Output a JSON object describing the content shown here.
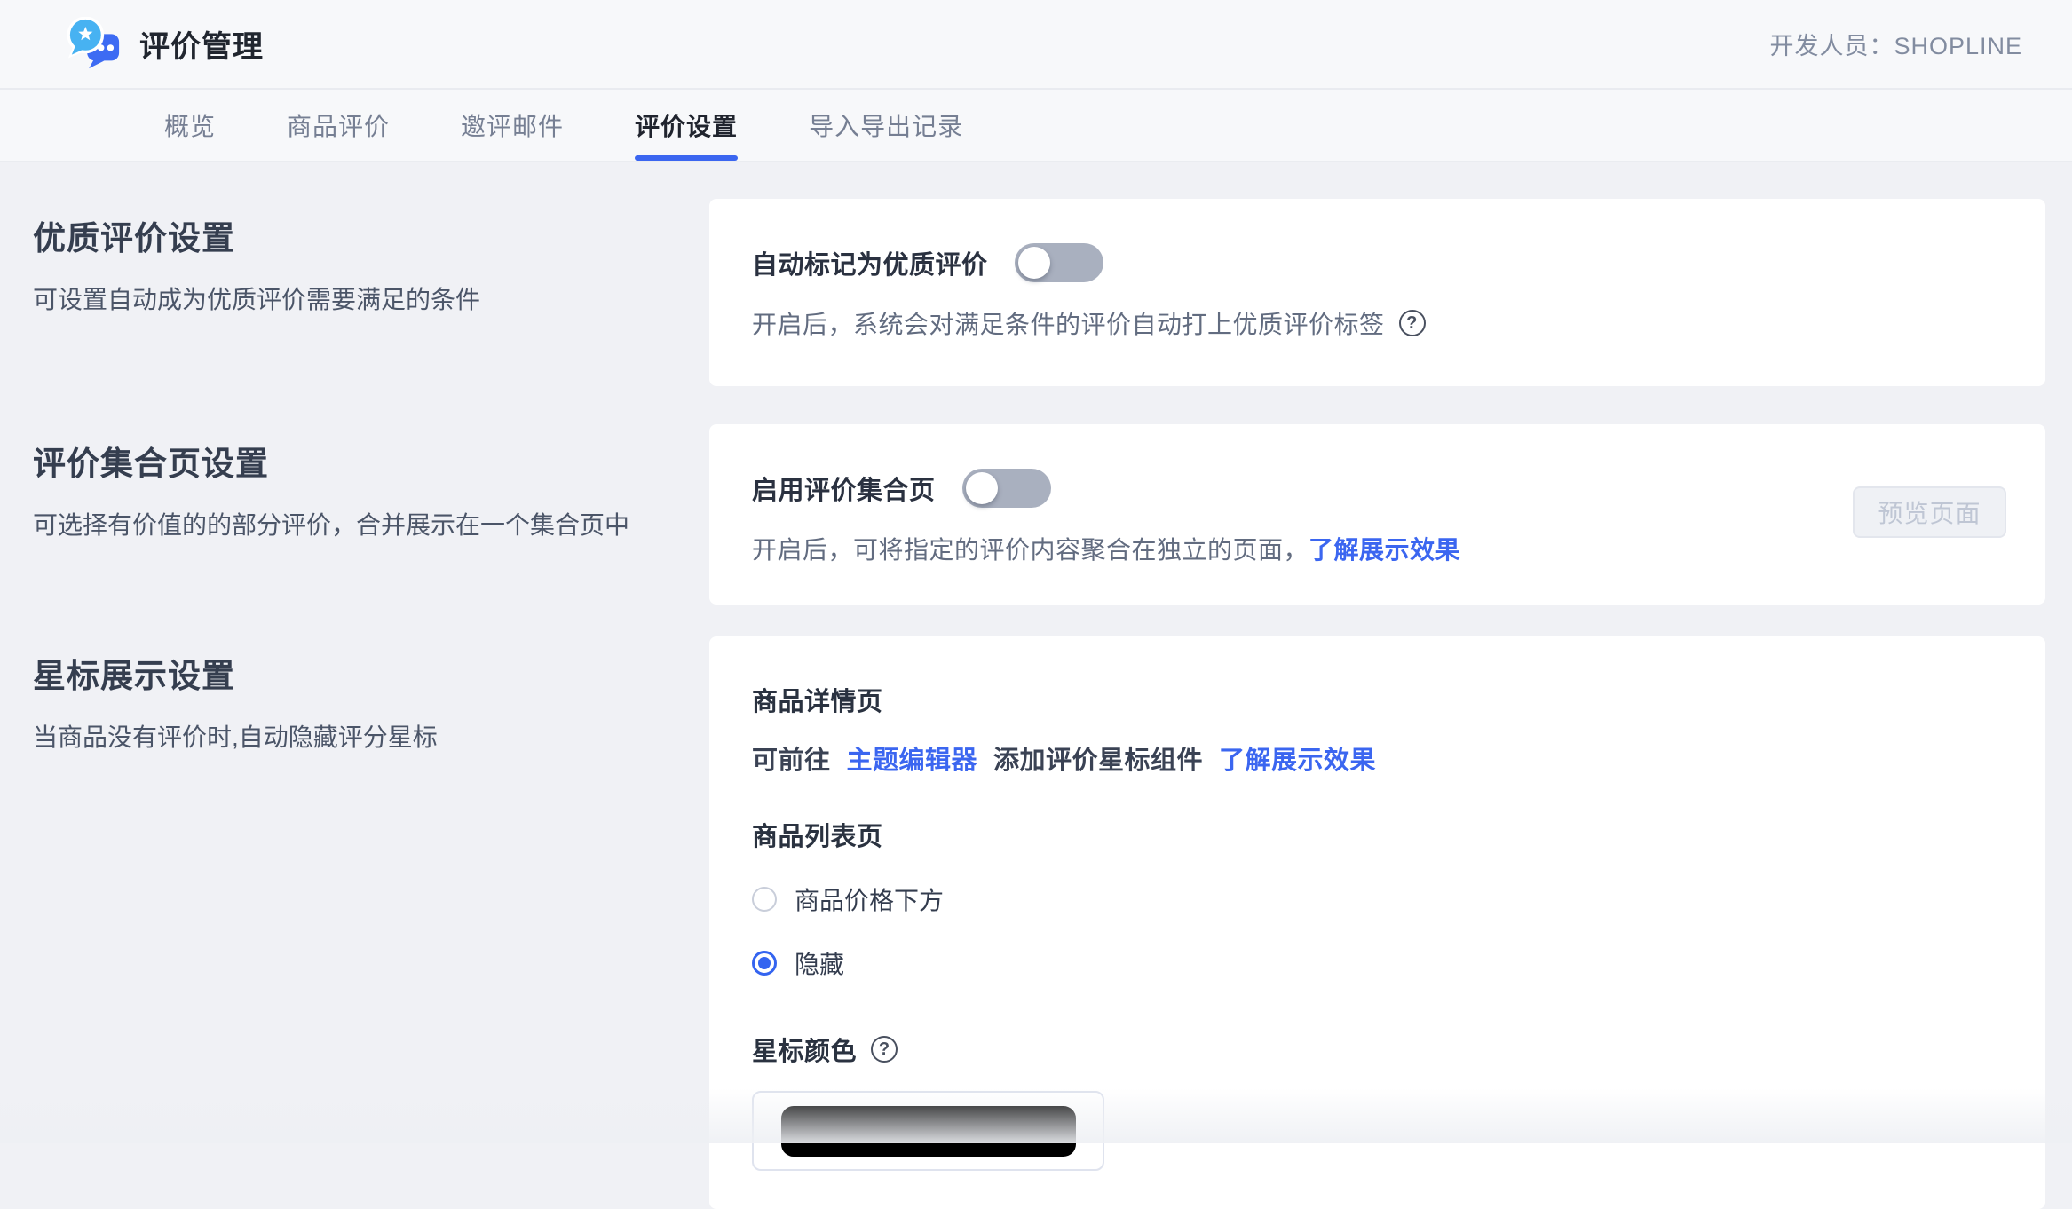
{
  "header": {
    "title": "评价管理",
    "right_text": "开发人员：SHOPLINE"
  },
  "tabs": [
    {
      "label": "概览",
      "active": false
    },
    {
      "label": "商品评价",
      "active": false
    },
    {
      "label": "邀评邮件",
      "active": false
    },
    {
      "label": "评价设置",
      "active": true
    },
    {
      "label": "导入导出记录",
      "active": false
    }
  ],
  "sections": [
    {
      "title": "优质评价设置",
      "description": "可设置自动成为优质评价需要满足的条件",
      "card": {
        "toggle_label": "自动标记为优质评价",
        "toggle_on": false,
        "description": "开启后，系统会对满足条件的评价自动打上优质评价标签"
      }
    },
    {
      "title": "评价集合页设置",
      "description": "可选择有价值的的部分评价，合并展示在一个集合页中",
      "card": {
        "toggle_label": "启用评价集合页",
        "toggle_on": false,
        "description_prefix": "开启后，可将指定的评价内容聚合在独立的页面，",
        "description_link": "了解展示效果",
        "preview_button_label": "预览页面",
        "preview_button_enabled": false
      }
    },
    {
      "title": "星标展示设置",
      "description": "当商品没有评价时,自动隐藏评分星标",
      "card": {
        "detail_page_label": "商品详情页",
        "detail_line": {
          "prefix": "可前往",
          "theme_editor_link": "主题编辑器",
          "middle": "添加评价星标组件",
          "effect_link": "了解展示效果"
        },
        "list_page_label": "商品列表页",
        "radios": [
          {
            "label": "商品价格下方",
            "selected": false
          },
          {
            "label": "隐藏",
            "selected": true
          }
        ],
        "star_color_label": "星标颜色",
        "star_color_value": "#000000"
      }
    }
  ],
  "icons": {
    "logo": "review-chat-bubbles-with-star",
    "help": "question-mark-circle"
  },
  "colors": {
    "accent_blue": "#3B66F0",
    "logo_light_blue": "#47B2F2",
    "logo_dark_blue": "#3D6BF3",
    "page_bg": "#F0F1F5",
    "band_bg": "#F7F8FA",
    "card_bg": "#FFFFFF",
    "toggle_off_track": "#A9B0BF",
    "disabled_button_text": "#BFC6D4"
  }
}
